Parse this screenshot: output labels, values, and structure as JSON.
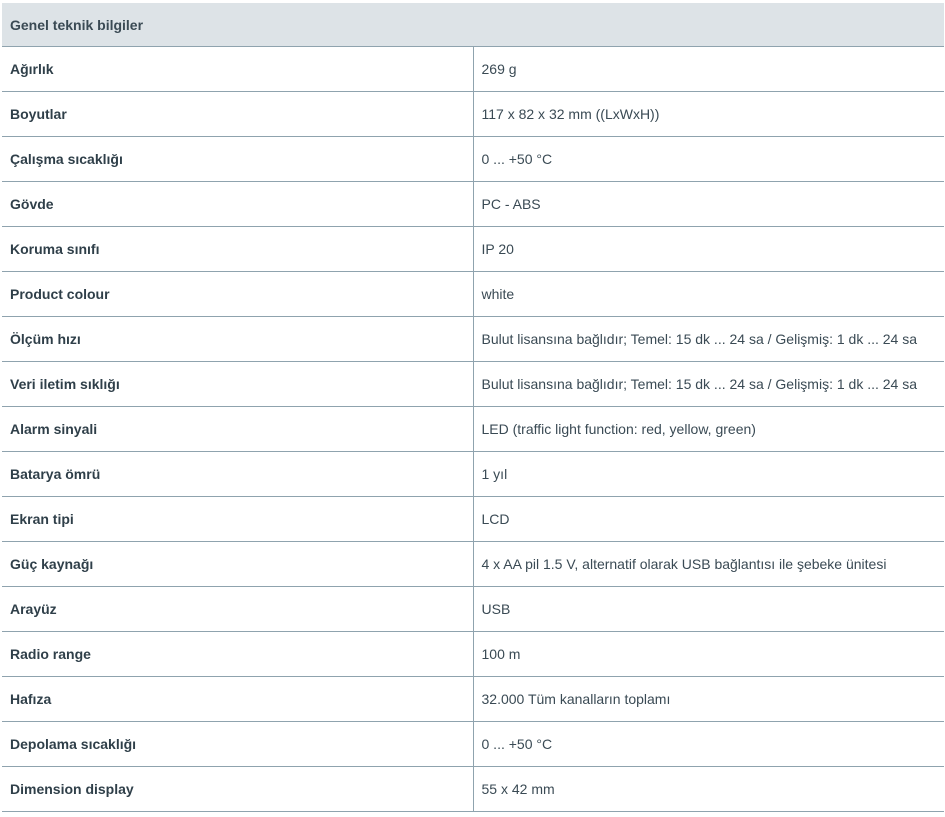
{
  "section": {
    "title": "Genel teknik bilgiler"
  },
  "rows": [
    {
      "label": "Ağırlık",
      "value": "269 g"
    },
    {
      "label": "Boyutlar",
      "value": "117 x 82 x 32 mm ((LxWxH))"
    },
    {
      "label": "Çalışma sıcaklığı",
      "value": "0 ... +50 °C"
    },
    {
      "label": "Gövde",
      "value": "PC - ABS"
    },
    {
      "label": "Koruma sınıfı",
      "value": "IP 20"
    },
    {
      "label": "Product colour",
      "value": "white"
    },
    {
      "label": "Ölçüm hızı",
      "value": "Bulut lisansına bağlıdır; Temel: 15 dk ... 24 sa / Gelişmiş: 1 dk ... 24 sa"
    },
    {
      "label": "Veri iletim sıklığı",
      "value": "Bulut lisansına bağlıdır; Temel: 15 dk ... 24 sa / Gelişmiş: 1 dk ... 24 sa"
    },
    {
      "label": "Alarm sinyali",
      "value": "LED (traffic light function: red, yellow, green)"
    },
    {
      "label": "Batarya ömrü",
      "value": "1 yıl"
    },
    {
      "label": "Ekran tipi",
      "value": "LCD"
    },
    {
      "label": "Güç kaynağı",
      "value": "4 x AA pil 1.5 V, alternatif olarak USB bağlantısı ile şebeke ünitesi"
    },
    {
      "label": "Arayüz",
      "value": "USB"
    },
    {
      "label": "Radio range",
      "value": "100 m"
    },
    {
      "label": "Hafıza",
      "value": "32.000 Tüm kanalların toplamı"
    },
    {
      "label": "Depolama sıcaklığı",
      "value": "0 ... +50 °C"
    },
    {
      "label": "Dimension display",
      "value": "55 x 42 mm"
    }
  ]
}
